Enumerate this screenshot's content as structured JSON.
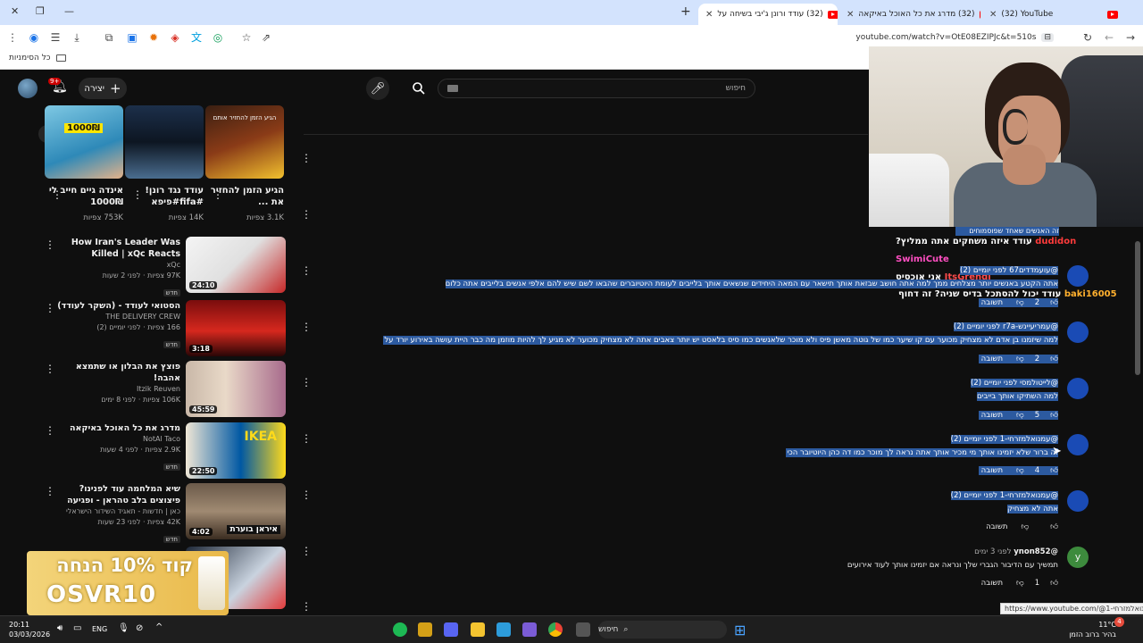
{
  "browser": {
    "tabs": [
      {
        "title": "(32) YouTube"
      },
      {
        "title": "(32) מדרג את כל האוכל באיקאה"
      },
      {
        "title": "(32) עודד ורונן ג'יבי בשיחה על"
      }
    ],
    "new_tab": "+",
    "url": "youtube.com/watch?v=OtE08EZIPJc&t=510s",
    "bookmarks_label": "כל הסימניות"
  },
  "youtube": {
    "search_placeholder": "חיפוש",
    "create_label": "יצירה",
    "notif_badge": "9+",
    "shorts": [
      {
        "title": "הגיע הזמן להחזיר את ...",
        "views": "3.1K צפיות"
      },
      {
        "title": "עודד נגד רונן! #fifa#פיפא",
        "views": "14K צפיות"
      },
      {
        "title": "אינדה גיים חייב לי 1000₪",
        "views": "753K צפיות"
      }
    ],
    "short_badge": "1000₪",
    "short_thumb_text": "הגיע הזמן להחזיר אותם",
    "recommended": [
      {
        "title": "How Iran's Leader Was Killed | xQc Reacts",
        "channel": "xQc",
        "meta": "97K צפיות · לפני 2 שעות",
        "badge": "חדש",
        "duration": "24:10"
      },
      {
        "title": "הסטואי לעודד - (השקר לעודד)",
        "channel": "THE DELIVERY CREW",
        "meta": "166 צפיות · לפני יומיים (2)",
        "badge": "חדש",
        "duration": "3:18"
      },
      {
        "title": "פוצץ את הבלון או שתמצא אהבה!",
        "channel": "Itzik Reuven",
        "meta": "106K צפיות · לפני 8 ימים",
        "badge": "",
        "duration": "45:59"
      },
      {
        "title": "מדרג את כל האוכל באיקאה",
        "channel": "NotAl Taco",
        "meta": "2.9K צפיות · לפני 4 שעות",
        "badge": "חדש",
        "duration": "22:50"
      },
      {
        "title": "שיא המלחמה עוד לפנינו? פיצוצים בלב טהראן - ופגיעה ישירה בבאר ...",
        "channel": "כאן | חדשות - תאגיד השידור הישראלי",
        "meta": "42K צפיות · לפני 23 שעות",
        "badge": "חדש",
        "duration": "4:02"
      }
    ],
    "rec_thumb_texts": [
      "IKEA",
      "איראן בוערת"
    ],
    "comments": [
      {
        "author": "@עועמדדים67",
        "time": "לפני יומיים (2)",
        "body": "אתה הקטע באנשים יותר מצלחים ממך למה אתה חושב שבזאת אותך תישאר עם המאה היחידים שנשאים אותך בלייבים לעומת היוטיוברים שהבאו לשם שיש להם אלפי אנשים בלייבים אתה כלום",
        "likes": "2",
        "reply": "תשובה"
      },
      {
        "author": "@עמריעיינש-r7a",
        "time": "לפני יומיים (2)",
        "body": "למה שיזמנו בן אדם לא מצחיק מכוער עם קו שיער כמו של גוטה מאשן פיס ולא מוכר שלאנשים כמו סיס בלאסט יש יותר צאבים אתה לא מצחיק מכוער לא מגיע לך להיות מוזמן מה כבר היית עושה באירוע יורד על כלם?",
        "likes": "2",
        "reply": "תשובה"
      },
      {
        "author": "@לייטולמסי",
        "time": "לפני יומיים (2)",
        "body": "למה השתיקו אותך בייבים",
        "likes": "5",
        "reply": "תשובה"
      },
      {
        "author": "@עמנואלמזרחי-1",
        "time": "לפני יומיים (2)",
        "body": "זה ברור שלא יזמינו אותך מי מכיר אותך אתה נראה לך מוכר כמו דה כהן היוטיובר הכי טוב",
        "likes": "4",
        "reply": "תשובה"
      },
      {
        "author": "@עמנואלמזרחי-1",
        "time": "לפני יומיים (2)",
        "body": "אתה לא מצחיק",
        "likes": "",
        "reply": "תשובה"
      },
      {
        "author": "@ynon852",
        "time": "לפני 3 ימים",
        "body": "תמשיך עם הדיבור הגברי שלך ונראה אם יזמינו אותך לעוד אירועים",
        "likes": "1",
        "reply": "תשובה"
      }
    ],
    "partial_comment_head": "זה האנשים שאחד שפוסמוחים",
    "chat": [
      {
        "user": "dudidon",
        "text": "עודד איזה משחקים אתה ממליץ?"
      },
      {
        "user": "SwimiCute",
        "text": ""
      },
      {
        "user": "ItsGrendi",
        "text": "אני אוכסיס"
      },
      {
        "user": "baki16005",
        "text": "עודד יכול להסתכל בדיס שניה? זה דחוף"
      }
    ],
    "status_url": "https://www.youtube.com/@עמנואלמזרחי-1"
  },
  "ad": {
    "line1": "קוד 10% הנחה",
    "line2": "OSVR10"
  },
  "taskbar": {
    "time": "20:11",
    "date": "03/03/2026",
    "lang": "ENG",
    "search": "חיפוש",
    "weather_temp": "11°C",
    "weather_desc": "בהיר ברוב הזמן",
    "notif_count": "4"
  }
}
